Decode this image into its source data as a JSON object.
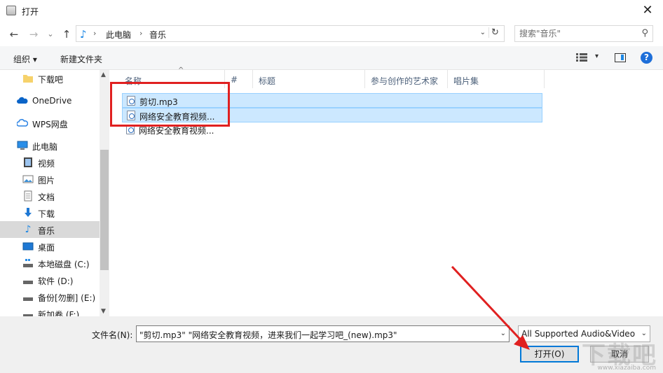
{
  "window": {
    "title": "打开",
    "close_glyph": "✕"
  },
  "nav": {
    "back": "←",
    "forward": "→",
    "dropdown": "⌄",
    "up": "↑",
    "breadcrumb": [
      "此电脑",
      "音乐"
    ],
    "separator": "›",
    "search_placeholder": "搜索\"音乐\""
  },
  "toolbar": {
    "organize": "组织 ▾",
    "new_folder": "新建文件夹",
    "help": "?"
  },
  "sidebar": {
    "items": [
      {
        "label": "下载吧",
        "icon": "folder-icon"
      },
      {
        "label": "OneDrive",
        "icon": "cloud-icon"
      },
      {
        "label": "WPS网盘",
        "icon": "cloud-icon"
      },
      {
        "label": "此电脑",
        "icon": "computer-icon"
      },
      {
        "label": "视频",
        "icon": "video-icon"
      },
      {
        "label": "图片",
        "icon": "picture-icon"
      },
      {
        "label": "文档",
        "icon": "document-icon"
      },
      {
        "label": "下载",
        "icon": "download-icon"
      },
      {
        "label": "音乐",
        "icon": "music-icon"
      },
      {
        "label": "桌面",
        "icon": "desktop-icon"
      },
      {
        "label": "本地磁盘 (C:)",
        "icon": "drive-icon"
      },
      {
        "label": "软件 (D:)",
        "icon": "drive-icon"
      },
      {
        "label": "备份[勿删] (E:)",
        "icon": "drive-icon"
      },
      {
        "label": "新加卷 (F:)",
        "icon": "drive-icon"
      }
    ],
    "selected_label": "音乐"
  },
  "columns": [
    "名称",
    "#",
    "标题",
    "参与创作的艺术家",
    "唱片集"
  ],
  "files": [
    {
      "name": "剪切.mp3",
      "selected": true
    },
    {
      "name": "网络安全教育视频...",
      "selected": true
    },
    {
      "name": "网络安全教育视频...",
      "selected": false
    }
  ],
  "footer": {
    "filename_label": "文件名(N):",
    "filename_value": "\"剪切.mp3\" \"网络安全教育视频，进来我们一起学习吧_(new).mp3\"",
    "filetype_value": "All Supported Audio&Video",
    "open_button": "打开(O)",
    "cancel_button": "取消"
  },
  "watermark": {
    "text": "下载吧",
    "small": "www.xiazaiba.com"
  },
  "colors": {
    "selection": "#cce8ff",
    "accent": "#0078d7",
    "annotation_red": "#e02020"
  }
}
